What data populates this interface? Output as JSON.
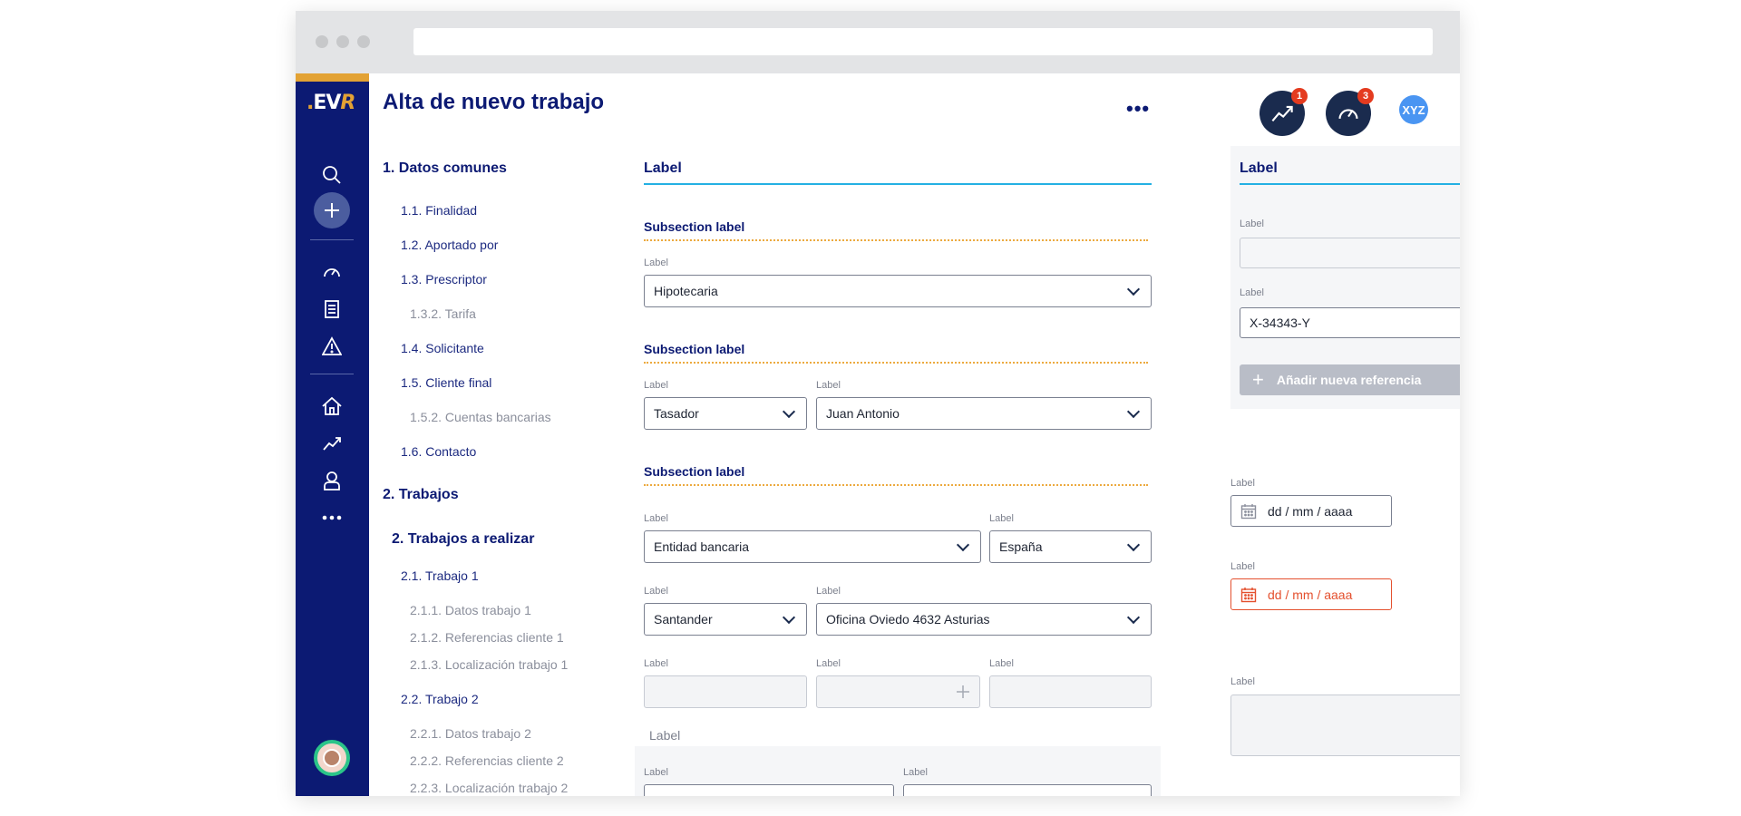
{
  "app": {
    "logo": {
      "dot": ".",
      "ev": "EV",
      "r": "R"
    },
    "title": "Alta de nuevo trabajo",
    "more_label": "•••",
    "notifications": [
      {
        "icon": "trend-chart-icon",
        "badge": "1"
      },
      {
        "icon": "speedometer-icon",
        "badge": "3"
      }
    ],
    "user_initials": "XYZ"
  },
  "sidebar": {
    "icons": [
      "search-icon",
      "plus-icon",
      "speedometer-icon",
      "document-icon",
      "warning-icon",
      "home-icon",
      "trend-icon",
      "user-icon",
      "more-icon"
    ]
  },
  "toc": [
    {
      "label": "1. Datos comunes",
      "level": 1
    },
    {
      "label": "1.1. Finalidad",
      "level": 2
    },
    {
      "label": "1.2. Aportado por",
      "level": 2
    },
    {
      "label": "1.3. Prescriptor",
      "level": 2
    },
    {
      "label": "1.3.2. Tarifa",
      "level": 3
    },
    {
      "label": "1.4. Solicitante",
      "level": 2
    },
    {
      "label": "1.5. Cliente final",
      "level": 2
    },
    {
      "label": "1.5.2. Cuentas bancarias",
      "level": 3
    },
    {
      "label": "1.6. Contacto",
      "level": 2
    },
    {
      "label": "2. Trabajos",
      "level": 1
    },
    {
      "label": "2. Trabajos a realizar",
      "level": 1
    },
    {
      "label": "2.1. Trabajo 1",
      "level": 2
    },
    {
      "label": "2.1.1. Datos trabajo 1",
      "level": 3
    },
    {
      "label": "2.1.2. Referencias cliente 1",
      "level": 3
    },
    {
      "label": "2.1.3. Localización trabajo 1",
      "level": 3
    },
    {
      "label": "2.2. Trabajo 2",
      "level": 2
    },
    {
      "label": "2.2.1. Datos trabajo 2",
      "level": 3
    },
    {
      "label": "2.2.2. Referencias cliente 2",
      "level": 3
    },
    {
      "label": "2.2.3. Localización trabajo 2",
      "level": 3
    }
  ],
  "main": {
    "section_title": "Label",
    "subsections": [
      "Subsection label",
      "Subsection label",
      "Subsection label"
    ],
    "field_label": "Label",
    "values": {
      "finalidad": "Hipotecaria",
      "aportado": "Tasador",
      "nombre": "Juan Antonio",
      "entidad": "Entidad bancaria",
      "pais": "España",
      "banco": "Santander",
      "oficina": "Oficina Oviedo 4632 Asturias"
    },
    "bottom_group_label": "Label"
  },
  "right_panel": {
    "section_title": "Label",
    "field_label": "Label",
    "reference_value": "X-34343-Y",
    "add_reference_label": "Añadir nueva referencia",
    "date_placeholder": "dd / mm / aaaa",
    "colors": {
      "error": "#e4502e",
      "accent": "#24b0e3",
      "navy": "#0c1a73"
    }
  }
}
